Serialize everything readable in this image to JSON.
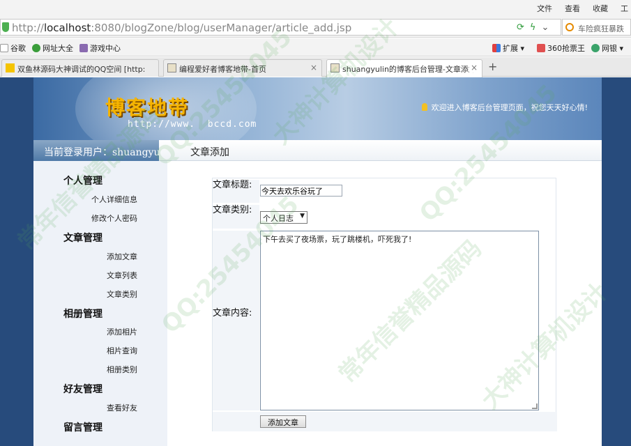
{
  "browser": {
    "menu": [
      "文件",
      "查看",
      "收藏",
      "工"
    ],
    "url_scheme_host": "http://",
    "url_host": "localhost",
    "url_rest": ":8080/blogZone/blog/userManager/article_add.jsp",
    "search_text": "车险疯狂暴跌",
    "bookmarks": [
      "谷歌",
      "网址大全",
      "游戏中心"
    ],
    "right_tools": [
      "扩展",
      "360抢票王",
      "网银"
    ],
    "tabs": [
      {
        "label": "双鱼林源码大神调试的QQ空间 [http:"
      },
      {
        "label": "编程爱好者博客地带-首页"
      },
      {
        "label": "shuangyulin的博客后台管理-文章添加"
      }
    ],
    "new_tab": "+"
  },
  "header": {
    "logo_cn": "博客地带",
    "logo_url": "http://www.  bccd.com",
    "welcome": "欢迎进入博客后台管理页面，祝您天天好心情!"
  },
  "bar": {
    "current_user": "当前登录用户：shuangyulin",
    "crumb": "文章添加"
  },
  "sidebar": {
    "personal": {
      "title": "个人管理",
      "items": [
        "个人详细信息",
        "修改个人密码"
      ]
    },
    "article": {
      "title": "文章管理",
      "items": [
        "添加文章",
        "文章列表",
        "文章类别"
      ]
    },
    "album": {
      "title": "相册管理",
      "items": [
        "添加相片",
        "相片查询",
        "相册类别"
      ]
    },
    "friends": {
      "title": "好友管理",
      "items": [
        "查看好友"
      ]
    },
    "messages": {
      "title": "留言管理"
    }
  },
  "form": {
    "title_label": "文章标题:",
    "title_value": "今天去欢乐谷玩了",
    "category_label": "文章类别:",
    "category_value": "个人日志",
    "content_label": "文章内容:",
    "content_value": "下午去买了夜场票，玩了跳楼机，吓死我了!",
    "submit": "添加文章"
  },
  "watermarks": [
    "常年信誉精品源码",
    "QQ:25454045",
    "大神计算机设计",
    "QQ:25454045",
    "常年信誉精品源码",
    "QQ:25454045",
    "大神计算机设计"
  ]
}
